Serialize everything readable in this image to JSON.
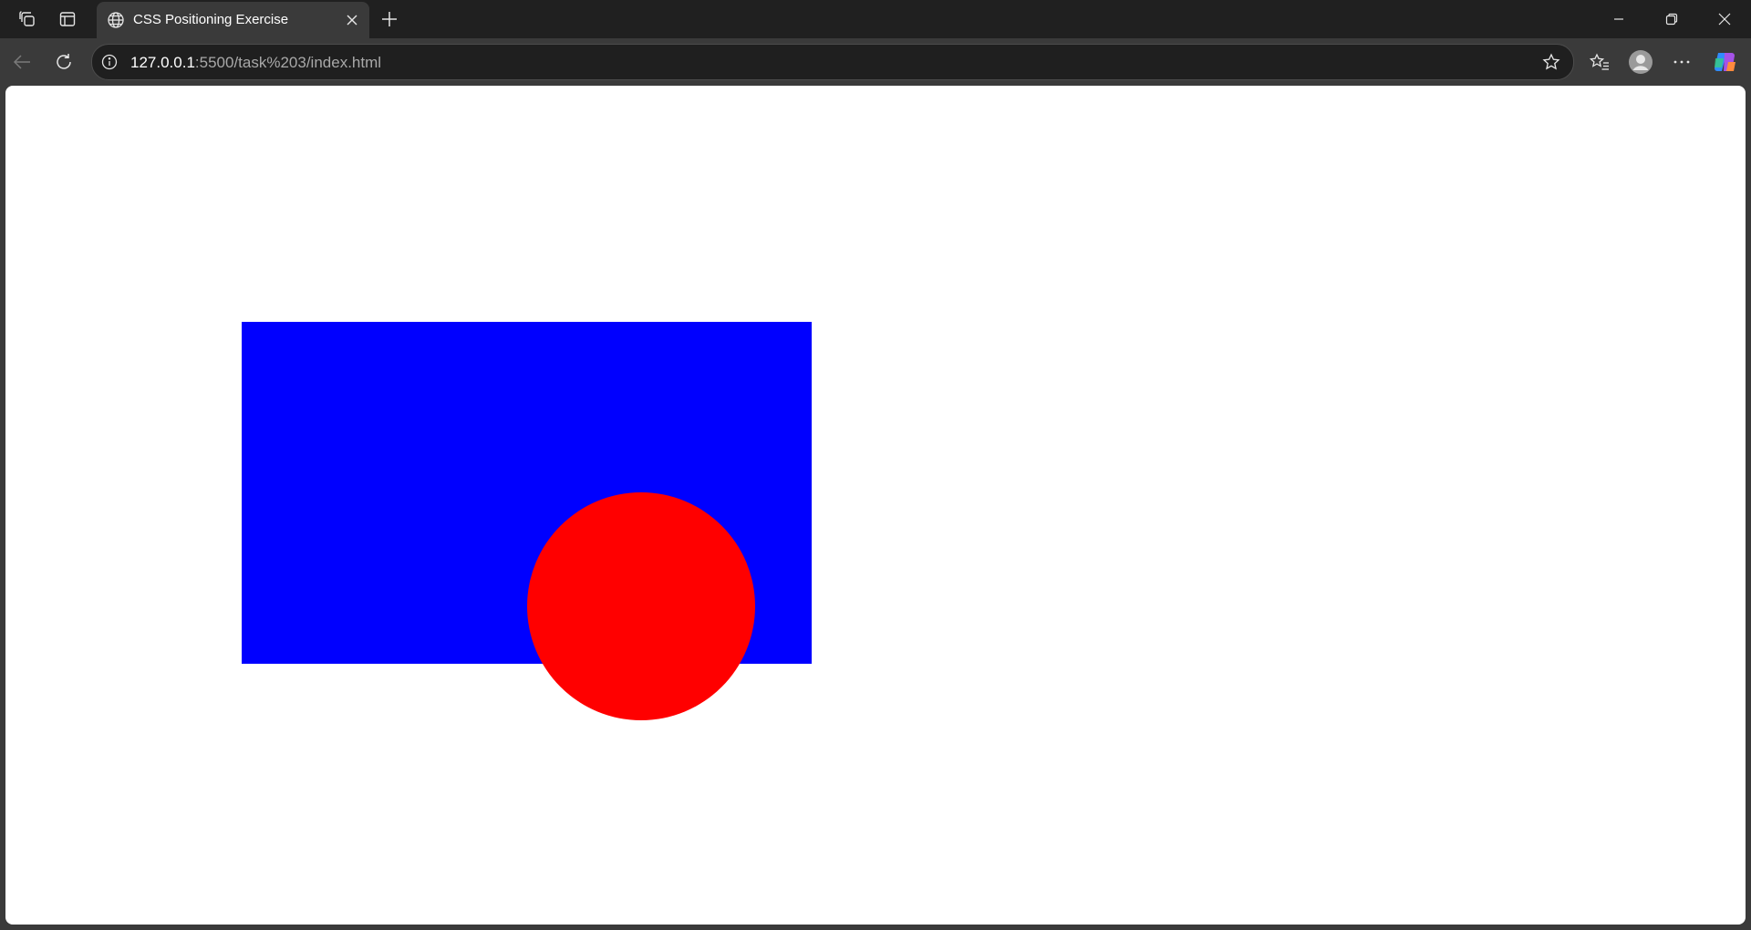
{
  "tab": {
    "title": "CSS Positioning Exercise",
    "favicon": "globe-icon"
  },
  "address_bar": {
    "url_host": "127.0.0.1",
    "url_rest": ":5500/task%203/index.html"
  },
  "page": {
    "box_color": "#0000ff",
    "circle_color": "#ff0000"
  }
}
